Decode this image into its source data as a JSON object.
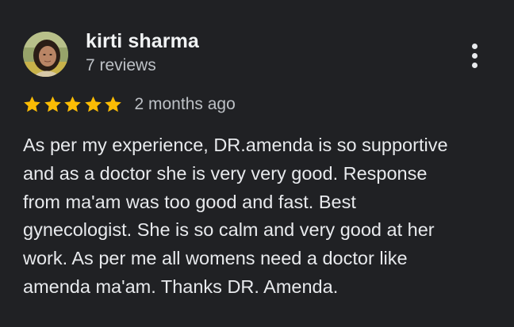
{
  "review": {
    "reviewer_name": "kirti sharma",
    "review_count": "7 reviews",
    "rating": 5,
    "rating_max": 5,
    "time_ago": "2 months ago",
    "text": "As per my experience, DR.amenda is so supportive\nand as a doctor she is very very good. Response\nfrom ma'am was too good and fast. Best\ngynecologist. She is so calm and very good at her\nwork. As per me all womens need a doctor like\namenda ma'am. Thanks DR. Amenda."
  },
  "icons": {
    "more": "more-vert-icon",
    "star": "star-icon",
    "avatar": "profile-photo"
  },
  "colors": {
    "background": "#202124",
    "star": "#fbbc04",
    "primary_text": "#e8eaed",
    "secondary_text": "#bdc1c6"
  }
}
